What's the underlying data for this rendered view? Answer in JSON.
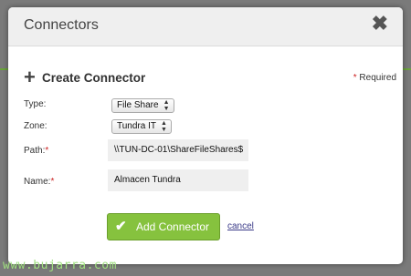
{
  "dialog": {
    "title": "Connectors",
    "close_icon": "close-icon",
    "close_glyph": "✖"
  },
  "section": {
    "plus_glyph": "+",
    "title": "Create Connector",
    "required_star": "*",
    "required_label": " Required"
  },
  "form": {
    "type": {
      "label": "Type:",
      "value": "File Share"
    },
    "zone": {
      "label": "Zone:",
      "value": "Tundra IT"
    },
    "path": {
      "label": "Path:",
      "required": "*",
      "value": "\\\\TUN-DC-01\\ShareFileShares$"
    },
    "name": {
      "label": "Name:",
      "required": "*",
      "value": "Almacen Tundra"
    }
  },
  "actions": {
    "check_glyph": "✔",
    "add_label": "Add Connector",
    "cancel_label": "cancel"
  },
  "watermark": "www.bujarra.com",
  "colors": {
    "accent_green": "#86c23e",
    "required_red": "#cc2222",
    "header_bg": "#efefef",
    "overlay": "#7a7a7a"
  }
}
